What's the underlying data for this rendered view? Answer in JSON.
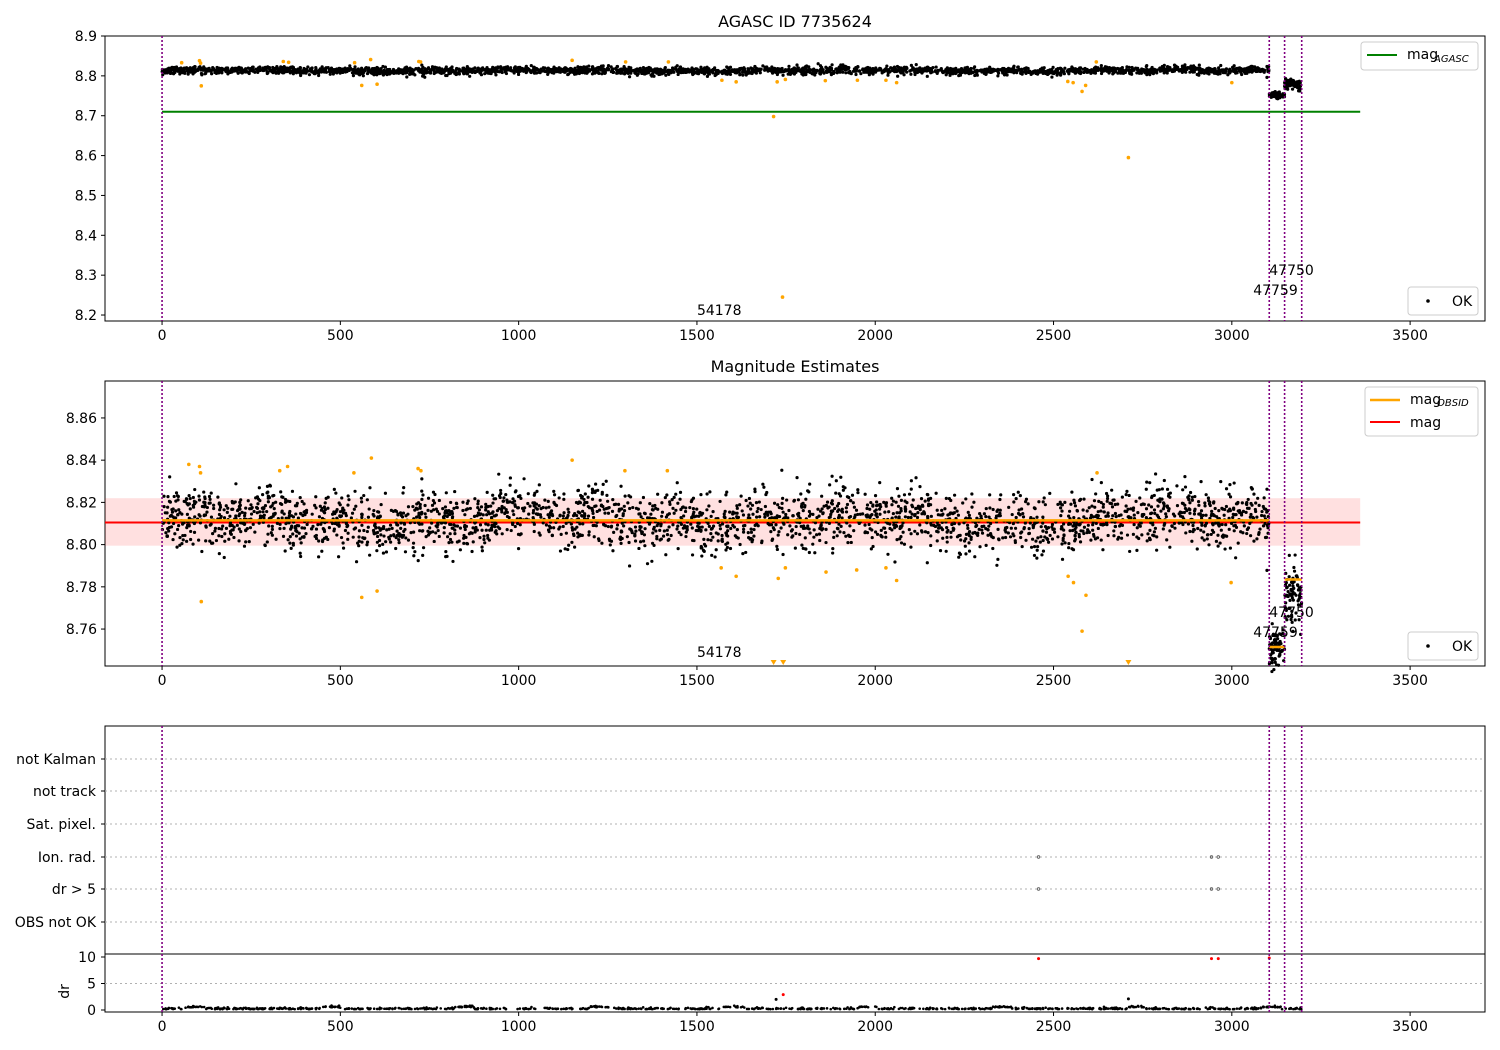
{
  "figure_title": "AGASC ID 7735624",
  "colors": {
    "ok_point": "#000000",
    "outlier_point": "#ffa500",
    "agasc_line": "#008000",
    "obsid_line": "#ffa500",
    "mag_line": "#ff0000",
    "band_fill": "#ff0000",
    "obsid_divider": "#800080",
    "flag_point": "#ff0000",
    "grid": "#b0b0b0"
  },
  "obsid_labels": [
    "54178",
    "47759",
    "47750"
  ],
  "obsid_boundaries": [
    0,
    3105,
    3148,
    3196
  ],
  "chart_data": [
    {
      "type": "scatter",
      "title": "",
      "xlim": [
        -160,
        3710
      ],
      "ylim": [
        8.185,
        8.9
      ],
      "x_ticks": [
        0,
        500,
        1000,
        1500,
        2000,
        2500,
        3000,
        3500
      ],
      "y_ticks": [
        8.2,
        8.3,
        8.4,
        8.5,
        8.6,
        8.7,
        8.8,
        8.9
      ],
      "y_tick_labels": [
        "8.2",
        "8.3",
        "8.4",
        "8.5",
        "8.6",
        "8.7",
        "8.8",
        "8.9"
      ],
      "x_range": [
        0,
        3196
      ],
      "agasc_mag": 8.71,
      "legend_top": {
        "label": "mag",
        "sub": "AGASC"
      },
      "legend_bottom": {
        "label": "OK"
      },
      "ok_segments": [
        {
          "x0": 0,
          "x1": 3105,
          "mean": 8.813,
          "spread": 0.006
        },
        {
          "x0": 3105,
          "x1": 3148,
          "mean": 8.752,
          "spread": 0.006
        },
        {
          "x0": 3148,
          "x1": 3196,
          "mean": 8.782,
          "spread": 0.007
        }
      ],
      "outliers": [
        [
          55,
          8.833
        ],
        [
          105,
          8.838
        ],
        [
          108,
          8.832
        ],
        [
          110,
          8.775
        ],
        [
          340,
          8.836
        ],
        [
          355,
          8.834
        ],
        [
          540,
          8.833
        ],
        [
          560,
          8.776
        ],
        [
          585,
          8.841
        ],
        [
          603,
          8.779
        ],
        [
          720,
          8.836
        ],
        [
          725,
          8.835
        ],
        [
          1150,
          8.839
        ],
        [
          1300,
          8.835
        ],
        [
          1420,
          8.835
        ],
        [
          1570,
          8.789
        ],
        [
          1610,
          8.785
        ],
        [
          1715,
          8.698
        ],
        [
          1725,
          8.785
        ],
        [
          1740,
          8.245
        ],
        [
          1748,
          8.791
        ],
        [
          1860,
          8.788
        ],
        [
          1950,
          8.789
        ],
        [
          2030,
          8.789
        ],
        [
          2060,
          8.783
        ],
        [
          2540,
          8.786
        ],
        [
          2555,
          8.783
        ],
        [
          2580,
          8.761
        ],
        [
          2590,
          8.776
        ],
        [
          2620,
          8.835
        ],
        [
          2710,
          8.595
        ],
        [
          3000,
          8.783
        ]
      ]
    },
    {
      "type": "scatter",
      "title": "Magnitude Estimates",
      "xlim": [
        -160,
        3710
      ],
      "ylim": [
        8.7425,
        8.8775
      ],
      "x_ticks": [
        0,
        500,
        1000,
        1500,
        2000,
        2500,
        3000,
        3500
      ],
      "y_ticks": [
        8.76,
        8.78,
        8.8,
        8.82,
        8.84,
        8.86
      ],
      "y_tick_labels": [
        "8.76",
        "8.78",
        "8.80",
        "8.82",
        "8.84",
        "8.86"
      ],
      "mag": 8.8105,
      "band": [
        8.7995,
        8.822
      ],
      "obsid_mean": [
        {
          "x0": 0,
          "x1": 3105,
          "value": 8.8115
        },
        {
          "x0": 3105,
          "x1": 3148,
          "value": 8.7515
        },
        {
          "x0": 3148,
          "x1": 3196,
          "value": 8.7835
        }
      ],
      "legend_top": [
        {
          "label": "mag",
          "sub": "OBSID"
        },
        {
          "label": "mag",
          "sub": ""
        }
      ],
      "legend_bottom": {
        "label": "OK"
      },
      "ok_segments": [
        {
          "x0": 0,
          "x1": 3105,
          "mean": 8.8115,
          "spread": 0.0085
        },
        {
          "x0": 3105,
          "x1": 3148,
          "mean": 8.752,
          "spread": 0.006
        },
        {
          "x0": 3148,
          "x1": 3196,
          "mean": 8.78,
          "spread": 0.009
        }
      ],
      "outliers": [
        [
          75,
          8.838
        ],
        [
          105,
          8.837
        ],
        [
          108,
          8.834
        ],
        [
          110,
          8.773
        ],
        [
          330,
          8.835
        ],
        [
          352,
          8.837
        ],
        [
          538,
          8.834
        ],
        [
          560,
          8.775
        ],
        [
          587,
          8.841
        ],
        [
          603,
          8.778
        ],
        [
          718,
          8.836
        ],
        [
          726,
          8.835
        ],
        [
          1150,
          8.84
        ],
        [
          1298,
          8.835
        ],
        [
          1417,
          8.835
        ],
        [
          1568,
          8.789
        ],
        [
          1610,
          8.785
        ],
        [
          1728,
          8.784
        ],
        [
          1748,
          8.789
        ],
        [
          1862,
          8.787
        ],
        [
          1948,
          8.788
        ],
        [
          2030,
          8.789
        ],
        [
          2060,
          8.783
        ],
        [
          2541,
          8.785
        ],
        [
          2556,
          8.782
        ],
        [
          2580,
          8.759
        ],
        [
          2591,
          8.776
        ],
        [
          2622,
          8.834
        ],
        [
          2998,
          8.782
        ]
      ],
      "below_range_markers": [
        1715,
        1742,
        2710
      ]
    },
    {
      "type": "scatter",
      "title": "",
      "xlim": [
        -160,
        3710
      ],
      "x_ticks": [
        0,
        500,
        1000,
        1500,
        2000,
        2500,
        3000,
        3500
      ],
      "flag_categories": [
        "not Kalman",
        "not track",
        "Sat. pixel.",
        "Ion. rad.",
        "dr > 5",
        "OBS not OK"
      ],
      "flag_points": [
        {
          "category": "Ion. rad.",
          "x": [
            2458,
            2943,
            2962
          ]
        },
        {
          "category": "dr > 5",
          "x": [
            2458,
            2943,
            2962
          ]
        }
      ],
      "dr_label": "dr",
      "dr_ylim": [
        -0.5,
        11
      ],
      "dr_ticks": [
        0,
        5,
        10
      ],
      "dr_high_points": [
        [
          2458,
          9.7
        ],
        [
          2943,
          9.7
        ],
        [
          2962,
          9.7
        ],
        [
          3105,
          9.8
        ],
        [
          1722,
          2.0
        ],
        [
          1742,
          2.9
        ],
        [
          2710,
          2.1
        ]
      ]
    }
  ]
}
